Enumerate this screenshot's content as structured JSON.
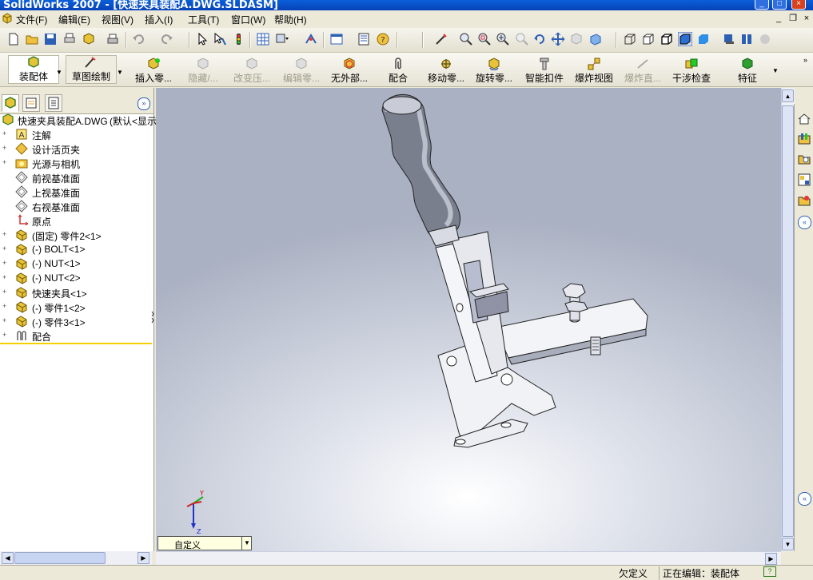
{
  "window": {
    "title": "SolidWorks 2007 - [快速夹具装配A.DWG.SLDASM]"
  },
  "menu": [
    "文件(F)",
    "编辑(E)",
    "视图(V)",
    "插入(I)",
    "工具(T)",
    "窗口(W)",
    "帮助(H)"
  ],
  "command_manager": [
    {
      "label": "装配体",
      "enabled": true
    },
    {
      "label": "草图绘制",
      "enabled": true
    },
    {
      "label": "插入零...",
      "enabled": true
    },
    {
      "label": "隐藏/...",
      "enabled": false
    },
    {
      "label": "改变压...",
      "enabled": false
    },
    {
      "label": "编辑零...",
      "enabled": false
    },
    {
      "label": "无外部...",
      "enabled": true
    },
    {
      "label": "配合",
      "enabled": true
    },
    {
      "label": "移动零...",
      "enabled": true
    },
    {
      "label": "旋转零...",
      "enabled": true
    },
    {
      "label": "智能扣件",
      "enabled": true
    },
    {
      "label": "爆炸视图",
      "enabled": true
    },
    {
      "label": "爆炸直...",
      "enabled": false
    },
    {
      "label": "干涉检查",
      "enabled": true
    },
    {
      "label": "特征",
      "enabled": true
    }
  ],
  "feature_tree": {
    "root": "快速夹具装配A.DWG",
    "root_config": "(默认<显示",
    "items": [
      {
        "label": "注解",
        "icon": "annotation-icon"
      },
      {
        "label": "设计活页夹",
        "icon": "binder-icon"
      },
      {
        "label": "光源与相机",
        "icon": "light-icon"
      },
      {
        "label": "前视基准面",
        "icon": "plane-icon"
      },
      {
        "label": "上视基准面",
        "icon": "plane-icon"
      },
      {
        "label": "右视基准面",
        "icon": "plane-icon"
      },
      {
        "label": "原点",
        "icon": "origin-icon"
      },
      {
        "label": "(固定) 零件2<1>",
        "icon": "part-icon"
      },
      {
        "label": "(-) BOLT<1>",
        "icon": "part-icon"
      },
      {
        "label": "(-) NUT<1>",
        "icon": "part-icon"
      },
      {
        "label": "(-) NUT<2>",
        "icon": "part-icon"
      },
      {
        "label": "快速夹具<1>",
        "icon": "part-icon"
      },
      {
        "label": "(-) 零件1<2>",
        "icon": "part-icon"
      },
      {
        "label": "(-) 零件3<1>",
        "icon": "part-icon"
      },
      {
        "label": "配合",
        "icon": "mates-icon"
      }
    ]
  },
  "view_orientation": "自定义",
  "triad": {
    "y": "Y",
    "z": "Z"
  },
  "status": {
    "left": "欠定义",
    "right": "正在编辑：装配体"
  },
  "colors": {
    "title": "#0a5fd8",
    "viewport_top": "#aab1c2",
    "selection": "#ffd400"
  }
}
